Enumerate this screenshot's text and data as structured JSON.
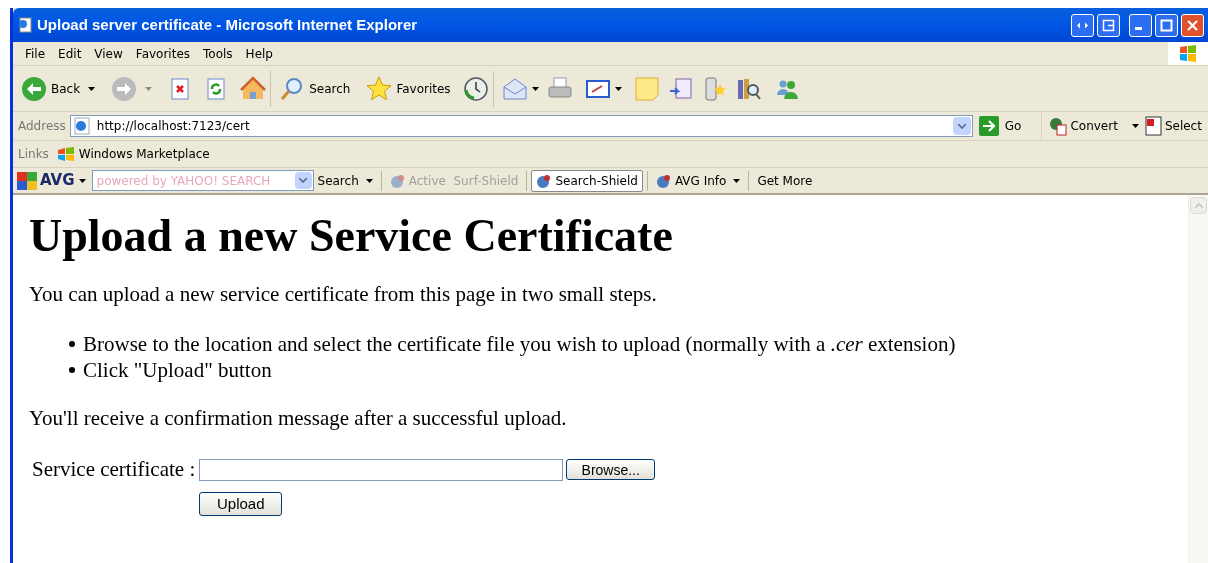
{
  "window": {
    "title": "Upload server certificate - Microsoft Internet Explorer"
  },
  "menu": [
    "File",
    "Edit",
    "View",
    "Favorites",
    "Tools",
    "Help"
  ],
  "toolbar": {
    "back": "Back",
    "search": "Search",
    "favorites": "Favorites"
  },
  "address_bar": {
    "label": "Address",
    "value": "http://localhost:7123/cert",
    "go": "Go",
    "convert": "Convert",
    "select": "Select"
  },
  "links_bar": {
    "label": "Links",
    "items": [
      "Windows Marketplace"
    ]
  },
  "avg_bar": {
    "brand": "AVG",
    "search_placeholder": "powered by YAHOO! SEARCH",
    "items": [
      {
        "label": "Search",
        "kind": "dropdown",
        "disabled": false,
        "pressed": false
      },
      {
        "label": "Active  Surf-Shield",
        "kind": "icon",
        "disabled": true,
        "pressed": false
      },
      {
        "label": "Search-Shield",
        "kind": "icon",
        "disabled": false,
        "pressed": true
      },
      {
        "label": "AVG Info",
        "kind": "icondropdown",
        "disabled": false,
        "pressed": false
      },
      {
        "label": "Get More",
        "kind": "plain",
        "disabled": false,
        "pressed": false
      }
    ]
  },
  "page": {
    "heading": "Upload a new Service Certificate",
    "intro": "You can upload a new service certificate from this page in two small steps.",
    "steps": [
      "Browse to the location and select the certificate file you wish to upload (normally with a *.cer* extension)",
      "Click \"Upload\" button"
    ],
    "note": "You'll receive a confirmation message after a successful upload.",
    "form": {
      "label": "Service certificate :",
      "browse": "Browse...",
      "upload": "Upload"
    }
  }
}
